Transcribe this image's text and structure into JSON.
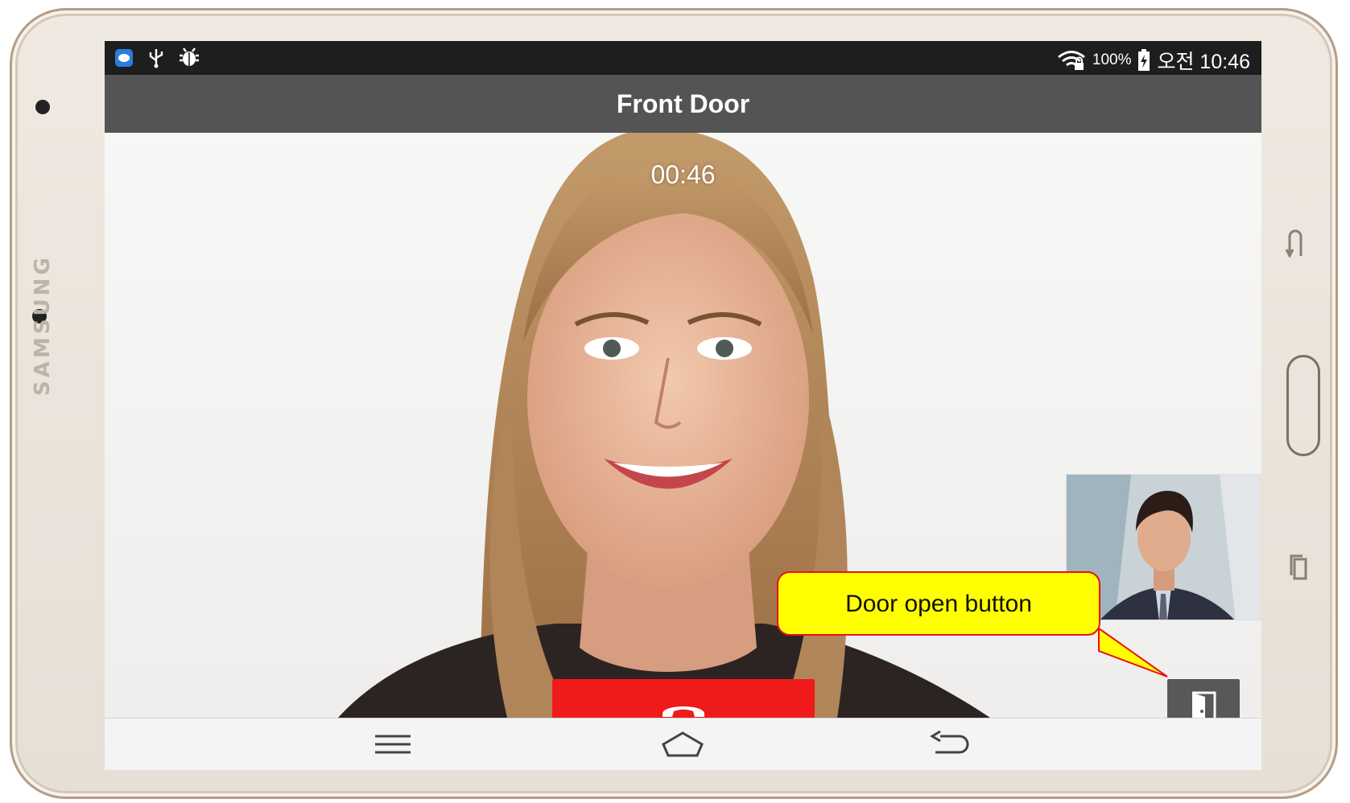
{
  "device": {
    "brand": "SAMSUNG"
  },
  "status_bar": {
    "left_icons": [
      "app-notification-icon",
      "usb-icon",
      "android-debug-icon"
    ],
    "wifi_icon": "wifi-locked-icon",
    "battery_percent": "100%",
    "battery_icon": "battery-charging-icon",
    "clock": "오전 10:46"
  },
  "app": {
    "title": "Front Door"
  },
  "call": {
    "timer": "00:46",
    "hangup_icon": "phone-hangup-icon",
    "door_open_icon": "door-open-icon"
  },
  "callout": {
    "text": "Door open button"
  },
  "navigation": {
    "menu_icon": "menu-icon",
    "home_icon": "home-icon",
    "back_icon": "back-icon"
  },
  "colors": {
    "hangup": "#ef1b1b",
    "title_bar": "#545454",
    "callout_fill": "#ffff00",
    "callout_border": "#e8101a",
    "door_button": "#585858"
  }
}
